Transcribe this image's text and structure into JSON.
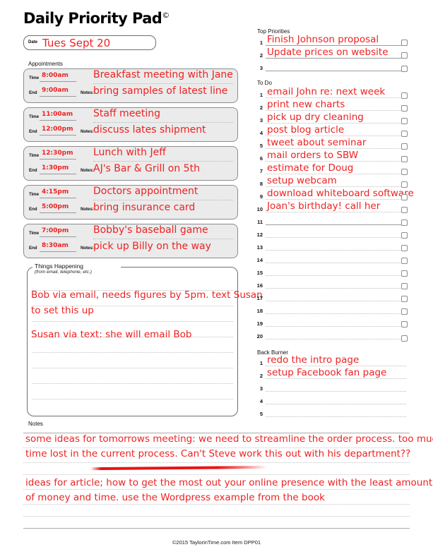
{
  "header": {
    "title": "Daily Priority Pad",
    "copyright_mark": "©",
    "date_label": "Date",
    "date_value": "Tues Sept 20"
  },
  "appointments": {
    "label": "Appointments",
    "time_label": "Time",
    "end_label": "End",
    "notes_label": "Notes:",
    "items": [
      {
        "time": "8:00am",
        "end": "9:00am",
        "title": "Breakfast meeting with Jane",
        "notes": "bring samples of latest line"
      },
      {
        "time": "11:00am",
        "end": "12:00pm",
        "title": "Staff meeting",
        "notes": "discuss lates shipment"
      },
      {
        "time": "12:30pm",
        "end": "1:30pm",
        "title": "Lunch with Jeff",
        "notes": "AJ's Bar & Grill on 5th"
      },
      {
        "time": "4:15pm",
        "end": "5:00pm",
        "title": "Doctors appointment",
        "notes": "bring insurance card"
      },
      {
        "time": "7:00pm",
        "end": "8:30am",
        "title": "Bobby's baseball game",
        "notes": "pick up Billy on the way"
      }
    ]
  },
  "things_happening": {
    "label": "Things Happening",
    "sublabel": "(from email, telephone, etc.)",
    "lines": [
      "Bob via email, needs figures by 5pm. text Susan",
      "to set this up",
      "",
      "Susan via text: she will email Bob",
      "",
      "",
      "",
      ""
    ]
  },
  "top_priorities": {
    "label": "Top Priorities",
    "items": [
      {
        "num": "1",
        "text": "Finish Johnson proposal"
      },
      {
        "num": "2",
        "text": "Update prices on website"
      },
      {
        "num": "3",
        "text": ""
      }
    ]
  },
  "todo": {
    "label": "To Do",
    "items": [
      {
        "num": "1",
        "text": "email John re: next week"
      },
      {
        "num": "2",
        "text": "print new charts"
      },
      {
        "num": "3",
        "text": "pick up dry cleaning"
      },
      {
        "num": "4",
        "text": "post blog article"
      },
      {
        "num": "5",
        "text": "tweet about seminar"
      },
      {
        "num": "6",
        "text": "mail orders to SBW"
      },
      {
        "num": "7",
        "text": "estimate for Doug"
      },
      {
        "num": "8",
        "text": "setup webcam"
      },
      {
        "num": "9",
        "text": "download whiteboard software"
      },
      {
        "num": "10",
        "text": "Joan's birthday! call her"
      },
      {
        "num": "11",
        "text": ""
      },
      {
        "num": "12",
        "text": ""
      },
      {
        "num": "13",
        "text": ""
      },
      {
        "num": "14",
        "text": ""
      },
      {
        "num": "15",
        "text": ""
      },
      {
        "num": "16",
        "text": ""
      },
      {
        "num": "17",
        "text": ""
      },
      {
        "num": "18",
        "text": ""
      },
      {
        "num": "19",
        "text": ""
      },
      {
        "num": "20",
        "text": ""
      }
    ]
  },
  "back_burner": {
    "label": "Back Burner",
    "items": [
      {
        "num": "1",
        "text": "redo the intro page"
      },
      {
        "num": "2",
        "text": "setup Facebook fan page"
      },
      {
        "num": "3",
        "text": ""
      },
      {
        "num": "4",
        "text": ""
      },
      {
        "num": "5",
        "text": ""
      }
    ]
  },
  "notes": {
    "label": "Notes",
    "lines": [
      "some ideas for tomorrows meeting: we need to streamline the order process. too much",
      "time lost in the current process. Can't Steve work this out with his department??",
      "",
      "ideas for article; how to get the most out your online presence with the least amount",
      "of money and time. use the Wordpress example from the book",
      "",
      "",
      ""
    ]
  },
  "footer": {
    "text": "©2015 TaylorinTime.com Item DPP01"
  },
  "colors": {
    "ink_red": "#ee2222",
    "rule_gray": "#bdbdbd",
    "box_fill": "#ebebeb"
  }
}
